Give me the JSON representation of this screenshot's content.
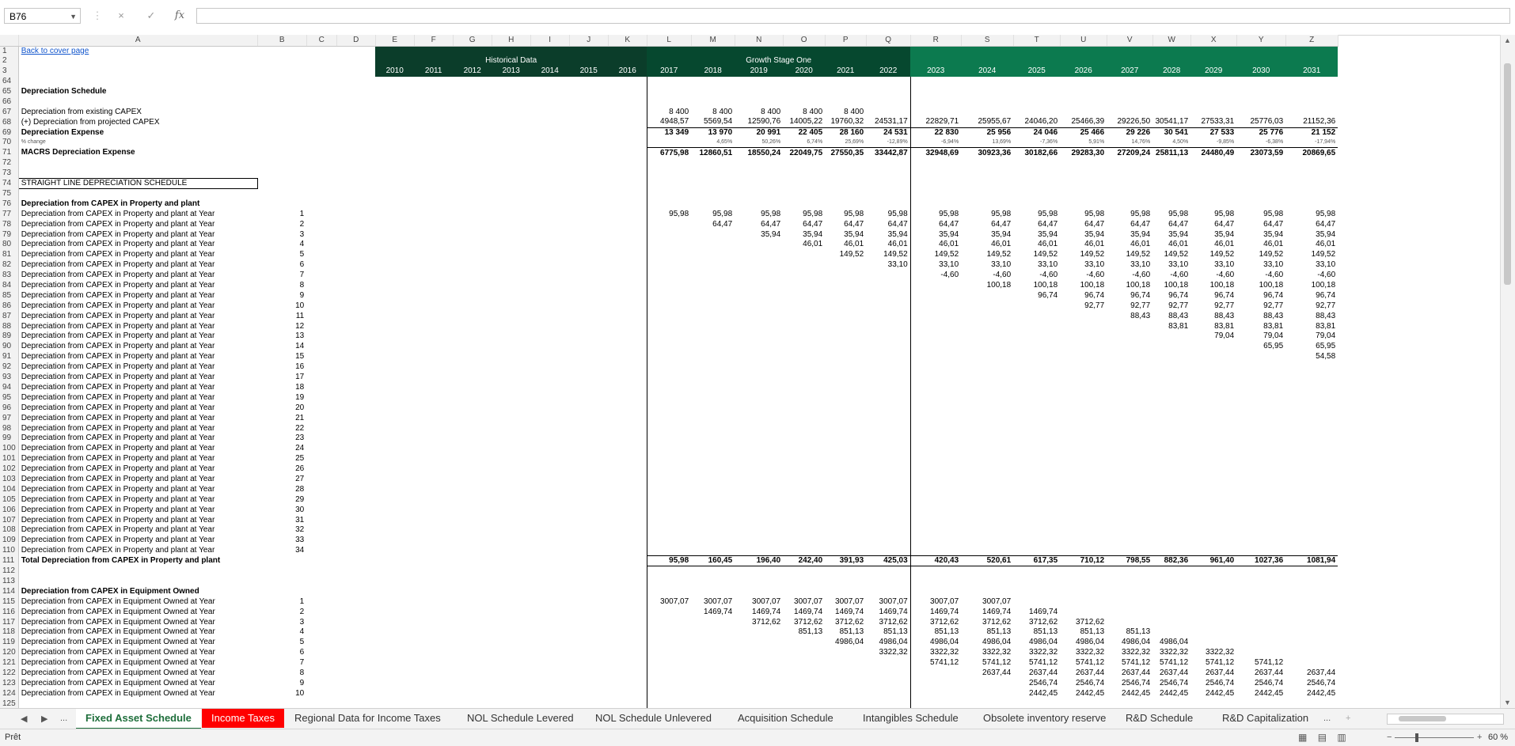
{
  "formula_bar": {
    "cell_ref": "B76",
    "cancel_icon": "×",
    "enter_icon": "✓",
    "fx_label": "fx",
    "formula": ""
  },
  "columns": [
    "A",
    "B",
    "C",
    "D",
    "E",
    "F",
    "G",
    "H",
    "I",
    "J",
    "K",
    "L",
    "M",
    "N",
    "O",
    "P",
    "Q",
    "R",
    "S",
    "T",
    "U",
    "V",
    "W",
    "X",
    "Y",
    "Z"
  ],
  "headers": {
    "back_link": "Back to cover page",
    "historical": "Historical Data",
    "growth_stage": "Growth Stage One",
    "years": [
      "2010",
      "2011",
      "2012",
      "2013",
      "2014",
      "2015",
      "2016",
      "2017",
      "2018",
      "2019",
      "2020",
      "2021",
      "2022",
      "2023",
      "2024",
      "2025",
      "2026",
      "2027",
      "2028",
      "2029",
      "2030",
      "2031"
    ]
  },
  "summary": {
    "title": "Depreciation Schedule",
    "rows": [
      {
        "label": "Depreciation from existing CAPEX",
        "values": [
          "8 400",
          "8 400",
          "8 400",
          "8 400",
          "8 400",
          "",
          "",
          "",
          "",
          "",
          "",
          "",
          "",
          "",
          ""
        ]
      },
      {
        "label": "(+) Depreciation from projected CAPEX",
        "values": [
          "4948,57",
          "5569,54",
          "12590,76",
          "14005,22",
          "19760,32",
          "24531,17",
          "22829,71",
          "25955,67",
          "24046,20",
          "25466,39",
          "29226,50",
          "30541,17",
          "27533,31",
          "25776,03",
          "21152,36"
        ]
      },
      {
        "label": "Depreciation Expense",
        "values": [
          "13 349",
          "13 970",
          "20 991",
          "22 405",
          "28 160",
          "24 531",
          "22 830",
          "25 956",
          "24 046",
          "25 466",
          "29 226",
          "30 541",
          "27 533",
          "25 776",
          "21 152"
        ]
      },
      {
        "label": "% change",
        "values": [
          "",
          "4,65%",
          "50,26%",
          "6,74%",
          "25,69%",
          "-12,89%",
          "-6,94%",
          "13,69%",
          "-7,36%",
          "5,91%",
          "14,76%",
          "4,50%",
          "-9,85%",
          "-6,38%",
          "-17,94%"
        ]
      },
      {
        "label": "MACRS Depreciation Expense",
        "values": [
          "6775,98",
          "12860,51",
          "18550,24",
          "22049,75",
          "27550,35",
          "33442,87",
          "32948,69",
          "30923,36",
          "30182,66",
          "29283,30",
          "27209,24",
          "25811,13",
          "24480,49",
          "23073,59",
          "20869,65"
        ]
      }
    ]
  },
  "straight_line_title": "STRAIGHT LINE DEPRECIATION SCHEDULE",
  "property": {
    "title": "Depreciation from CAPEX in Property and plant",
    "row_label": "Depreciation from CAPEX in Property and plant at Year",
    "rows": [
      [
        "95,98",
        "95,98",
        "95,98",
        "95,98",
        "95,98",
        "95,98",
        "95,98",
        "95,98",
        "95,98",
        "95,98",
        "95,98",
        "95,98",
        "95,98",
        "95,98",
        "95,98"
      ],
      [
        "",
        "64,47",
        "64,47",
        "64,47",
        "64,47",
        "64,47",
        "64,47",
        "64,47",
        "64,47",
        "64,47",
        "64,47",
        "64,47",
        "64,47",
        "64,47",
        "64,47"
      ],
      [
        "",
        "",
        "35,94",
        "35,94",
        "35,94",
        "35,94",
        "35,94",
        "35,94",
        "35,94",
        "35,94",
        "35,94",
        "35,94",
        "35,94",
        "35,94",
        "35,94"
      ],
      [
        "",
        "",
        "",
        "46,01",
        "46,01",
        "46,01",
        "46,01",
        "46,01",
        "46,01",
        "46,01",
        "46,01",
        "46,01",
        "46,01",
        "46,01",
        "46,01"
      ],
      [
        "",
        "",
        "",
        "",
        "149,52",
        "149,52",
        "149,52",
        "149,52",
        "149,52",
        "149,52",
        "149,52",
        "149,52",
        "149,52",
        "149,52",
        "149,52"
      ],
      [
        "",
        "",
        "",
        "",
        "",
        "33,10",
        "33,10",
        "33,10",
        "33,10",
        "33,10",
        "33,10",
        "33,10",
        "33,10",
        "33,10",
        "33,10"
      ],
      [
        "",
        "",
        "",
        "",
        "",
        "",
        "-4,60",
        "-4,60",
        "-4,60",
        "-4,60",
        "-4,60",
        "-4,60",
        "-4,60",
        "-4,60",
        "-4,60"
      ],
      [
        "",
        "",
        "",
        "",
        "",
        "",
        "",
        "100,18",
        "100,18",
        "100,18",
        "100,18",
        "100,18",
        "100,18",
        "100,18",
        "100,18"
      ],
      [
        "",
        "",
        "",
        "",
        "",
        "",
        "",
        "",
        "96,74",
        "96,74",
        "96,74",
        "96,74",
        "96,74",
        "96,74",
        "96,74"
      ],
      [
        "",
        "",
        "",
        "",
        "",
        "",
        "",
        "",
        "",
        "92,77",
        "92,77",
        "92,77",
        "92,77",
        "92,77",
        "92,77"
      ],
      [
        "",
        "",
        "",
        "",
        "",
        "",
        "",
        "",
        "",
        "",
        "88,43",
        "88,43",
        "88,43",
        "88,43",
        "88,43"
      ],
      [
        "",
        "",
        "",
        "",
        "",
        "",
        "",
        "",
        "",
        "",
        "",
        "83,81",
        "83,81",
        "83,81",
        "83,81"
      ],
      [
        "",
        "",
        "",
        "",
        "",
        "",
        "",
        "",
        "",
        "",
        "",
        "",
        "79,04",
        "79,04",
        "79,04"
      ],
      [
        "",
        "",
        "",
        "",
        "",
        "",
        "",
        "",
        "",
        "",
        "",
        "",
        "",
        "65,95",
        "65,95"
      ],
      [
        "",
        "",
        "",
        "",
        "",
        "",
        "",
        "",
        "",
        "",
        "",
        "",
        "",
        "",
        "54,58"
      ]
    ],
    "total_label": "Total Depreciation from CAPEX in Property and plant",
    "totals": [
      "95,98",
      "160,45",
      "196,40",
      "242,40",
      "391,93",
      "425,03",
      "420,43",
      "520,61",
      "617,35",
      "710,12",
      "798,55",
      "882,36",
      "961,40",
      "1027,36",
      "1081,94"
    ]
  },
  "equipment": {
    "title": "Depreciation from CAPEX in Equipment Owned",
    "row_label": "Depreciation from CAPEX in Equipment Owned at Year",
    "rows": [
      [
        "3007,07",
        "3007,07",
        "3007,07",
        "3007,07",
        "3007,07",
        "3007,07",
        "3007,07",
        "3007,07",
        "",
        "",
        "",
        "",
        "",
        "",
        ""
      ],
      [
        "",
        "1469,74",
        "1469,74",
        "1469,74",
        "1469,74",
        "1469,74",
        "1469,74",
        "1469,74",
        "1469,74",
        "",
        "",
        "",
        "",
        "",
        ""
      ],
      [
        "",
        "",
        "3712,62",
        "3712,62",
        "3712,62",
        "3712,62",
        "3712,62",
        "3712,62",
        "3712,62",
        "3712,62",
        "",
        "",
        "",
        "",
        ""
      ],
      [
        "",
        "",
        "",
        "851,13",
        "851,13",
        "851,13",
        "851,13",
        "851,13",
        "851,13",
        "851,13",
        "851,13",
        "",
        "",
        "",
        ""
      ],
      [
        "",
        "",
        "",
        "",
        "4986,04",
        "4986,04",
        "4986,04",
        "4986,04",
        "4986,04",
        "4986,04",
        "4986,04",
        "4986,04",
        "",
        "",
        ""
      ],
      [
        "",
        "",
        "",
        "",
        "",
        "3322,32",
        "3322,32",
        "3322,32",
        "3322,32",
        "3322,32",
        "3322,32",
        "3322,32",
        "3322,32",
        "",
        ""
      ],
      [
        "",
        "",
        "",
        "",
        "",
        "",
        "5741,12",
        "5741,12",
        "5741,12",
        "5741,12",
        "5741,12",
        "5741,12",
        "5741,12",
        "5741,12",
        ""
      ],
      [
        "",
        "",
        "",
        "",
        "",
        "",
        "",
        "2637,44",
        "2637,44",
        "2637,44",
        "2637,44",
        "2637,44",
        "2637,44",
        "2637,44",
        "2637,44"
      ],
      [
        "",
        "",
        "",
        "",
        "",
        "",
        "",
        "",
        "2546,74",
        "2546,74",
        "2546,74",
        "2546,74",
        "2546,74",
        "2546,74",
        "2546,74"
      ],
      [
        "",
        "",
        "",
        "",
        "",
        "",
        "",
        "",
        "2442,45",
        "2442,45",
        "2442,45",
        "2442,45",
        "2442,45",
        "2442,45",
        "2442,45"
      ]
    ]
  },
  "sheet_tabs": [
    "Fixed Asset Schedule",
    "Income Taxes",
    "Regional Data for Income Taxes",
    "NOL Schedule Levered",
    "NOL Schedule Unlevered",
    "Acquisition Schedule",
    "Intangibles Schedule",
    "Obsolete inventory reserve",
    "R&D Schedule",
    "R&D Capitalization"
  ],
  "tab_nav": {
    "prev": "◀",
    "next": "▶",
    "more": "...",
    "more_right": "...",
    "add": "+"
  },
  "status": {
    "ready": "Prêt",
    "zoom": "60 %",
    "minus": "−",
    "plus": "+"
  },
  "colors": {
    "historical_header": "#0b3d2a",
    "growth_header_dark": "#06482f",
    "growth_header_light": "#0c7a4f",
    "active_tab": "#1e6e3b",
    "red_tab": "#ff0000"
  }
}
